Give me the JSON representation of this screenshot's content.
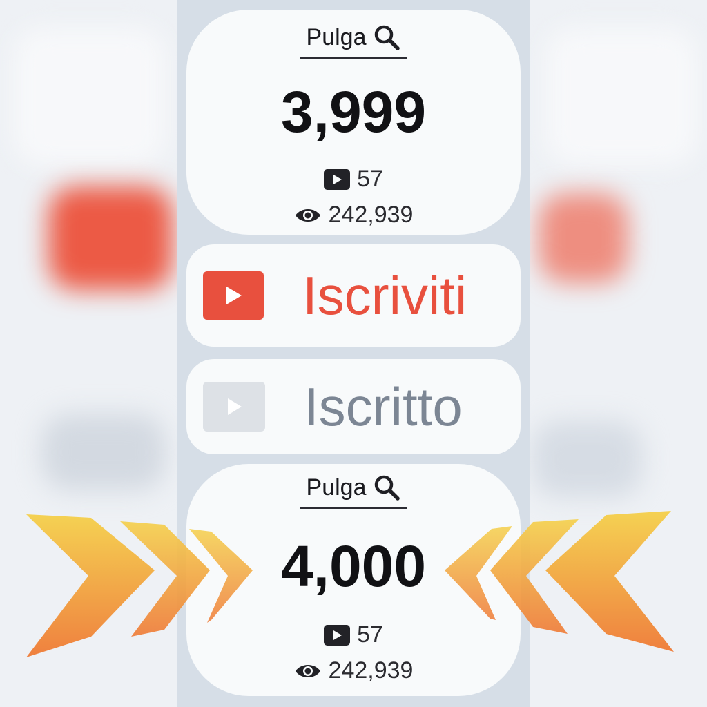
{
  "top_card": {
    "name": "Pulga",
    "subscribers": "3,999",
    "videos": "57",
    "views": "242,939"
  },
  "subscribe_button": {
    "label": "Iscriviti",
    "color": "#e8503e"
  },
  "subscribed_button": {
    "label": "Iscritto",
    "color": "#7c8694"
  },
  "bottom_card": {
    "name": "Pulga",
    "subscribers": "4,000",
    "videos": "57",
    "views": "242,939"
  },
  "icons": {
    "search": "search-icon",
    "video": "video-play-icon",
    "views": "eye-icon",
    "youtube": "youtube-logo-icon",
    "arrows": "chevron-arrows-icon"
  },
  "colors": {
    "arrow_top": "#f5d04a",
    "arrow_bottom": "#ef7a35"
  }
}
